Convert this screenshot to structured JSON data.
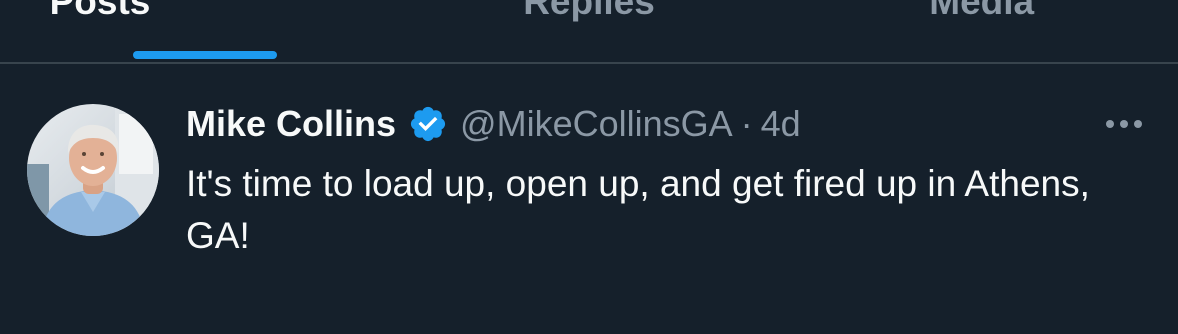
{
  "tabs": [
    {
      "label": "Posts",
      "active": true
    },
    {
      "label": "Replies",
      "active": false
    },
    {
      "label": "Media",
      "active": false
    }
  ],
  "tweet": {
    "display_name": "Mike Collins",
    "verified": true,
    "handle": "@MikeCollinsGA",
    "separator": "·",
    "time": "4d",
    "text": "It's time to load up, open up, and get fired up in Athens, GA!"
  },
  "icons": {
    "verified": "verified-badge-icon",
    "more": "more-options-icon"
  },
  "colors": {
    "background": "#15202b",
    "accent": "#1d9bf0",
    "text_primary": "#f7f9f9",
    "text_secondary": "#8b98a5",
    "divider": "#38444d"
  }
}
